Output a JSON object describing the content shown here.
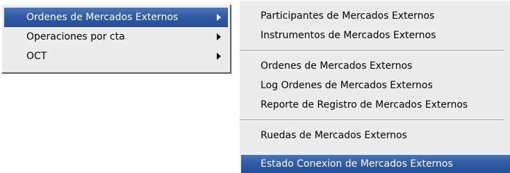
{
  "main_menu": {
    "items": [
      {
        "label": "Ordenes de Mercados Externos",
        "has_submenu": true,
        "selected": true
      },
      {
        "label": "Operaciones por cta",
        "has_submenu": true,
        "selected": false
      },
      {
        "label": "OCT",
        "has_submenu": true,
        "selected": false
      }
    ]
  },
  "submenu": {
    "groups": [
      {
        "items": [
          {
            "label": "Participantes de Mercados Externos"
          },
          {
            "label": "Instrumentos de Mercados Externos"
          }
        ]
      },
      {
        "items": [
          {
            "label": "Ordenes de Mercados Externos"
          },
          {
            "label": "Log Ordenes de Mercados Externos"
          },
          {
            "label": "Reporte de Registro de Mercados Externos"
          }
        ]
      },
      {
        "items": [
          {
            "label": "Ruedas de Mercados Externos"
          },
          {
            "label": "Estado Conexion de Mercados Externos",
            "selected": true
          }
        ]
      }
    ]
  },
  "colors": {
    "menu_background": "#ececec",
    "highlight": "#2e5aa3",
    "highlight_text": "#ffffff",
    "text": "#000000"
  }
}
